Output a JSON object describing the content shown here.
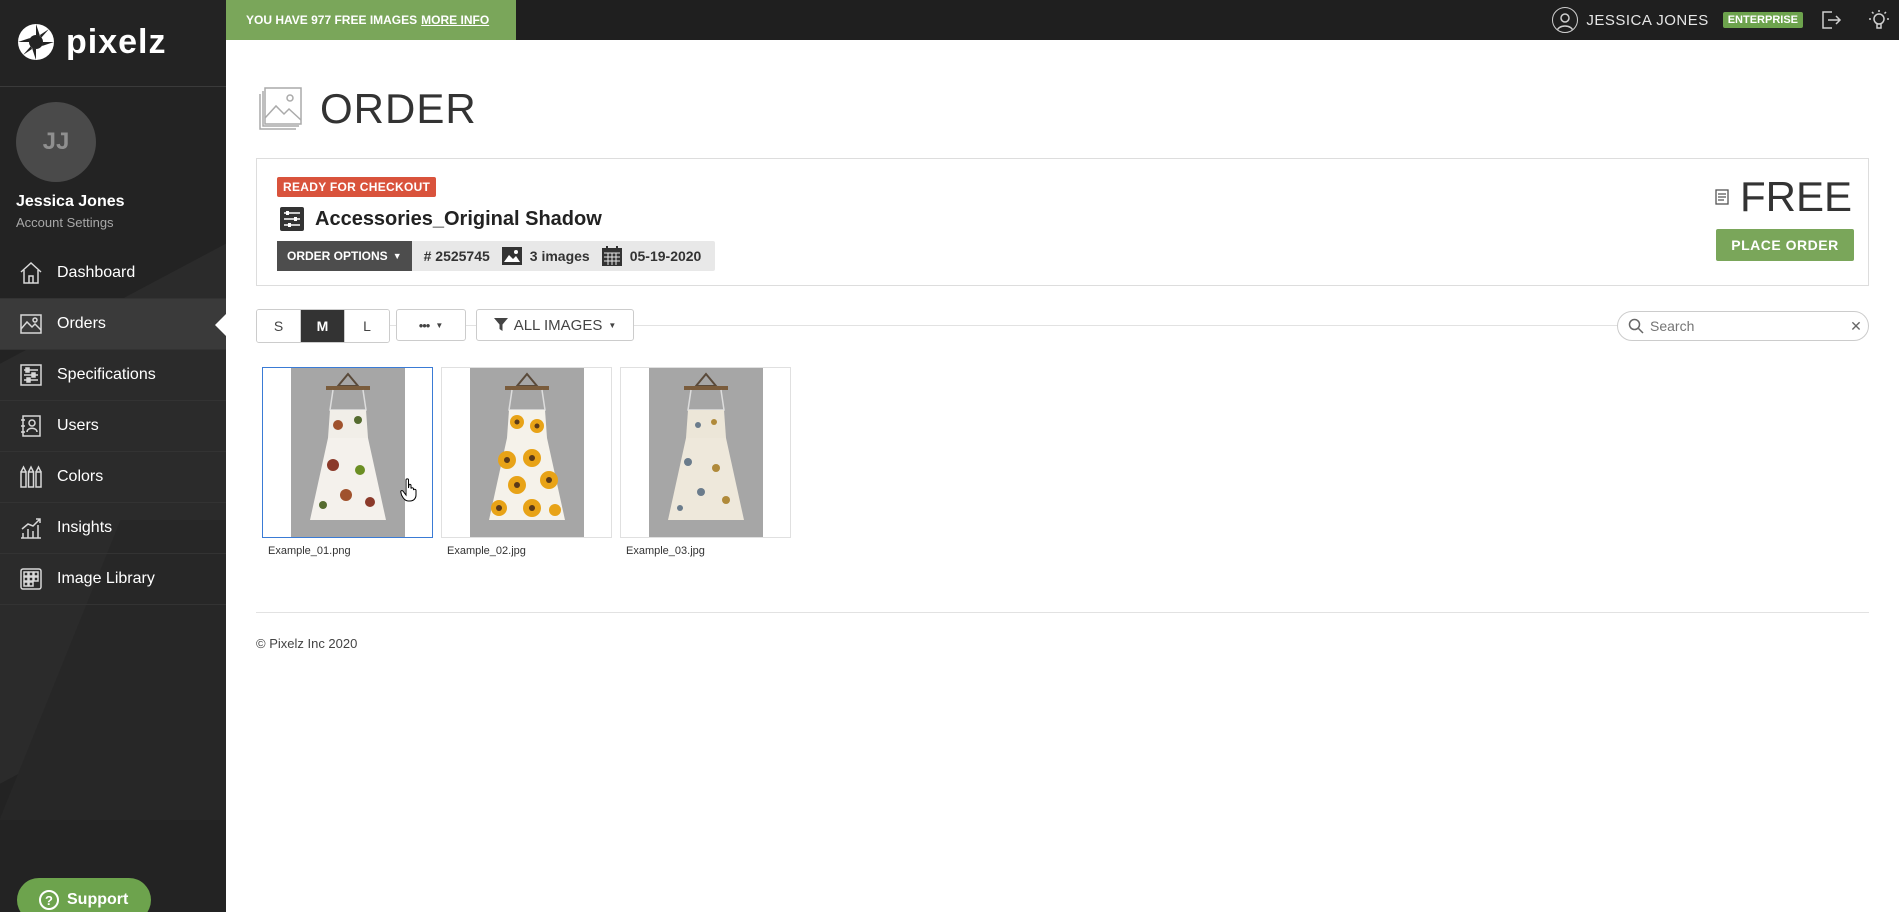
{
  "brand": {
    "name": "pixelz"
  },
  "sidebar": {
    "avatar_initials": "JJ",
    "user_name": "Jessica Jones",
    "account_settings": "Account Settings",
    "items": [
      {
        "label": "Dashboard",
        "icon": "home-icon",
        "active": false
      },
      {
        "label": "Orders",
        "icon": "image-icon",
        "active": true
      },
      {
        "label": "Specifications",
        "icon": "sliders-icon",
        "active": false
      },
      {
        "label": "Users",
        "icon": "address-book-icon",
        "active": false
      },
      {
        "label": "Colors",
        "icon": "color-swatch-icon",
        "active": false
      },
      {
        "label": "Insights",
        "icon": "chart-icon",
        "active": false
      },
      {
        "label": "Image Library",
        "icon": "grid-icon",
        "active": false
      }
    ],
    "support_label": "Support"
  },
  "topbar": {
    "promo_text": "YOU HAVE 977 FREE IMAGES",
    "promo_link": "MORE INFO",
    "user_name": "JESSICA JONES",
    "plan_badge": "ENTERPRISE"
  },
  "page": {
    "title": "ORDER"
  },
  "order": {
    "status_badge": "READY FOR CHECKOUT",
    "name": "Accessories_Original Shadow",
    "options_label": "ORDER OPTIONS",
    "number": "# 2525745",
    "images_count": "3 images",
    "date": "05-19-2020",
    "price": "FREE",
    "place_order_label": "PLACE ORDER"
  },
  "toolbar": {
    "sizes": [
      "S",
      "M",
      "L"
    ],
    "active_size": "M",
    "more_label": "•••",
    "filter_label": "ALL IMAGES",
    "search_placeholder": "Search"
  },
  "images": [
    {
      "filename": "Example_01.png",
      "pattern": "white-floral",
      "selected": true
    },
    {
      "filename": "Example_02.jpg",
      "pattern": "sunflower",
      "selected": false
    },
    {
      "filename": "Example_03.jpg",
      "pattern": "cream-floral",
      "selected": false
    }
  ],
  "footer": {
    "copyright": "© Pixelz Inc 2020"
  },
  "colors": {
    "accent_green": "#7aa65a",
    "badge_red": "#d9533c",
    "sidebar_bg": "#232323",
    "topbar_bg": "#1f1f1f"
  }
}
